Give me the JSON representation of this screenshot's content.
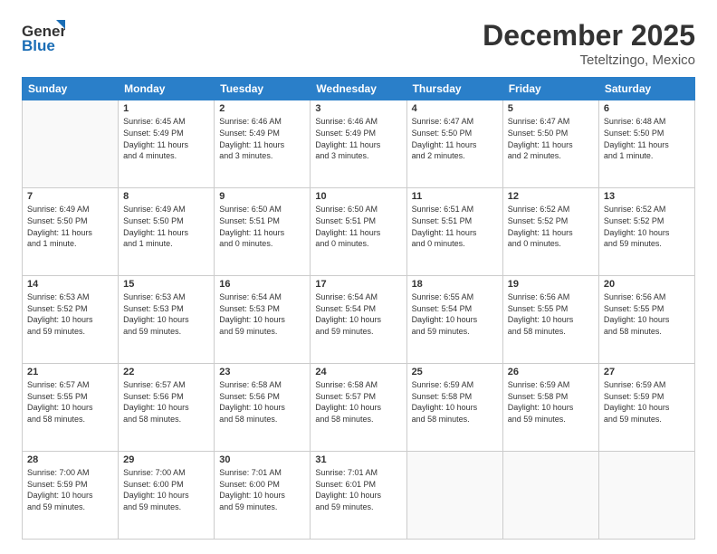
{
  "header": {
    "logo": {
      "general": "General",
      "blue": "Blue"
    },
    "title": "December 2025",
    "subtitle": "Teteltzingo, Mexico"
  },
  "calendar": {
    "columns": [
      "Sunday",
      "Monday",
      "Tuesday",
      "Wednesday",
      "Thursday",
      "Friday",
      "Saturday"
    ],
    "rows": [
      [
        {
          "day": "",
          "info": ""
        },
        {
          "day": "1",
          "info": "Sunrise: 6:45 AM\nSunset: 5:49 PM\nDaylight: 11 hours\nand 4 minutes."
        },
        {
          "day": "2",
          "info": "Sunrise: 6:46 AM\nSunset: 5:49 PM\nDaylight: 11 hours\nand 3 minutes."
        },
        {
          "day": "3",
          "info": "Sunrise: 6:46 AM\nSunset: 5:49 PM\nDaylight: 11 hours\nand 3 minutes."
        },
        {
          "day": "4",
          "info": "Sunrise: 6:47 AM\nSunset: 5:50 PM\nDaylight: 11 hours\nand 2 minutes."
        },
        {
          "day": "5",
          "info": "Sunrise: 6:47 AM\nSunset: 5:50 PM\nDaylight: 11 hours\nand 2 minutes."
        },
        {
          "day": "6",
          "info": "Sunrise: 6:48 AM\nSunset: 5:50 PM\nDaylight: 11 hours\nand 1 minute."
        }
      ],
      [
        {
          "day": "7",
          "info": "Sunrise: 6:49 AM\nSunset: 5:50 PM\nDaylight: 11 hours\nand 1 minute."
        },
        {
          "day": "8",
          "info": "Sunrise: 6:49 AM\nSunset: 5:50 PM\nDaylight: 11 hours\nand 1 minute."
        },
        {
          "day": "9",
          "info": "Sunrise: 6:50 AM\nSunset: 5:51 PM\nDaylight: 11 hours\nand 0 minutes."
        },
        {
          "day": "10",
          "info": "Sunrise: 6:50 AM\nSunset: 5:51 PM\nDaylight: 11 hours\nand 0 minutes."
        },
        {
          "day": "11",
          "info": "Sunrise: 6:51 AM\nSunset: 5:51 PM\nDaylight: 11 hours\nand 0 minutes."
        },
        {
          "day": "12",
          "info": "Sunrise: 6:52 AM\nSunset: 5:52 PM\nDaylight: 11 hours\nand 0 minutes."
        },
        {
          "day": "13",
          "info": "Sunrise: 6:52 AM\nSunset: 5:52 PM\nDaylight: 10 hours\nand 59 minutes."
        }
      ],
      [
        {
          "day": "14",
          "info": "Sunrise: 6:53 AM\nSunset: 5:52 PM\nDaylight: 10 hours\nand 59 minutes."
        },
        {
          "day": "15",
          "info": "Sunrise: 6:53 AM\nSunset: 5:53 PM\nDaylight: 10 hours\nand 59 minutes."
        },
        {
          "day": "16",
          "info": "Sunrise: 6:54 AM\nSunset: 5:53 PM\nDaylight: 10 hours\nand 59 minutes."
        },
        {
          "day": "17",
          "info": "Sunrise: 6:54 AM\nSunset: 5:54 PM\nDaylight: 10 hours\nand 59 minutes."
        },
        {
          "day": "18",
          "info": "Sunrise: 6:55 AM\nSunset: 5:54 PM\nDaylight: 10 hours\nand 59 minutes."
        },
        {
          "day": "19",
          "info": "Sunrise: 6:56 AM\nSunset: 5:55 PM\nDaylight: 10 hours\nand 58 minutes."
        },
        {
          "day": "20",
          "info": "Sunrise: 6:56 AM\nSunset: 5:55 PM\nDaylight: 10 hours\nand 58 minutes."
        }
      ],
      [
        {
          "day": "21",
          "info": "Sunrise: 6:57 AM\nSunset: 5:55 PM\nDaylight: 10 hours\nand 58 minutes."
        },
        {
          "day": "22",
          "info": "Sunrise: 6:57 AM\nSunset: 5:56 PM\nDaylight: 10 hours\nand 58 minutes."
        },
        {
          "day": "23",
          "info": "Sunrise: 6:58 AM\nSunset: 5:56 PM\nDaylight: 10 hours\nand 58 minutes."
        },
        {
          "day": "24",
          "info": "Sunrise: 6:58 AM\nSunset: 5:57 PM\nDaylight: 10 hours\nand 58 minutes."
        },
        {
          "day": "25",
          "info": "Sunrise: 6:59 AM\nSunset: 5:58 PM\nDaylight: 10 hours\nand 58 minutes."
        },
        {
          "day": "26",
          "info": "Sunrise: 6:59 AM\nSunset: 5:58 PM\nDaylight: 10 hours\nand 59 minutes."
        },
        {
          "day": "27",
          "info": "Sunrise: 6:59 AM\nSunset: 5:59 PM\nDaylight: 10 hours\nand 59 minutes."
        }
      ],
      [
        {
          "day": "28",
          "info": "Sunrise: 7:00 AM\nSunset: 5:59 PM\nDaylight: 10 hours\nand 59 minutes."
        },
        {
          "day": "29",
          "info": "Sunrise: 7:00 AM\nSunset: 6:00 PM\nDaylight: 10 hours\nand 59 minutes."
        },
        {
          "day": "30",
          "info": "Sunrise: 7:01 AM\nSunset: 6:00 PM\nDaylight: 10 hours\nand 59 minutes."
        },
        {
          "day": "31",
          "info": "Sunrise: 7:01 AM\nSunset: 6:01 PM\nDaylight: 10 hours\nand 59 minutes."
        },
        {
          "day": "",
          "info": ""
        },
        {
          "day": "",
          "info": ""
        },
        {
          "day": "",
          "info": ""
        }
      ]
    ]
  }
}
